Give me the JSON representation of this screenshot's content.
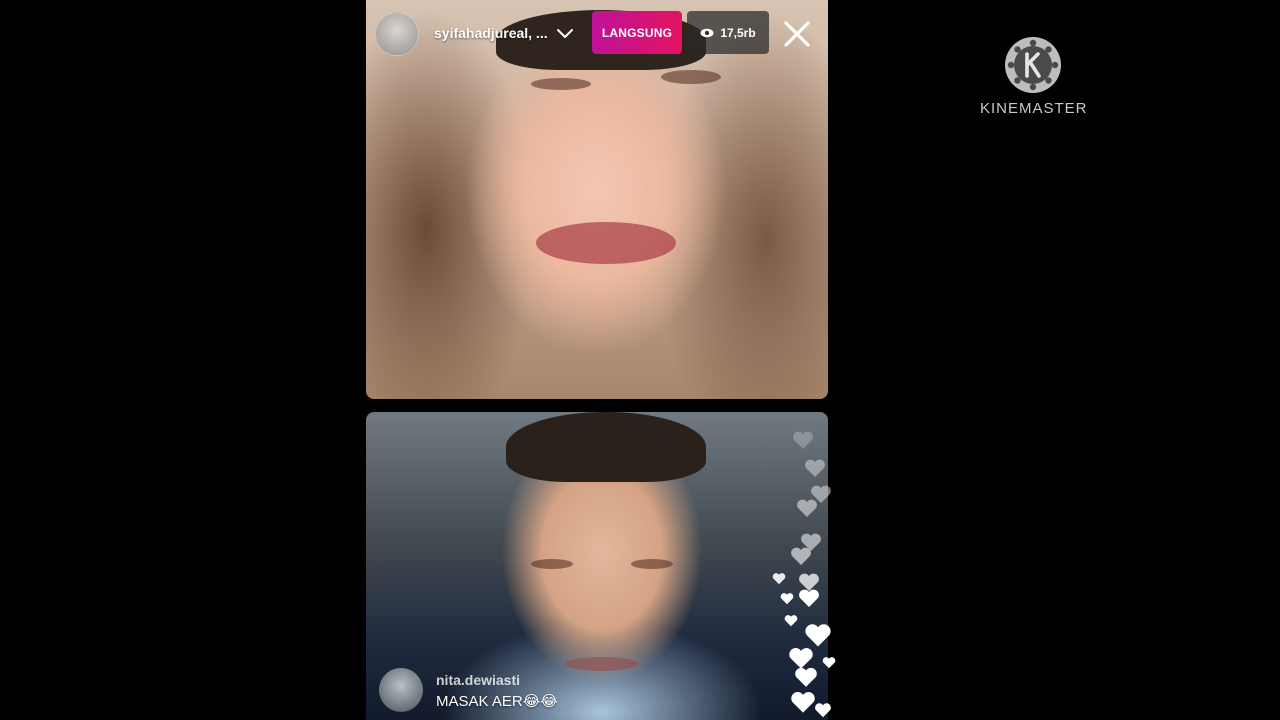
{
  "header": {
    "username": "syifahadjureal, ...",
    "live_label": "LANGSUNG",
    "viewer_count": "17,5rb"
  },
  "icons": {
    "dropdown": "chevron-down-icon",
    "viewers": "eye-icon",
    "close": "close-icon",
    "reaction": "heart-icon",
    "watermark_logo": "kinemaster-logo"
  },
  "comment": {
    "username": "nita.dewiasti",
    "text": "MASAK AER😂😂"
  },
  "watermark": {
    "text": "KINEMASTER"
  },
  "colors": {
    "live_badge_start": "#c0129a",
    "live_badge_end": "#e3135f",
    "background": "#000000"
  }
}
